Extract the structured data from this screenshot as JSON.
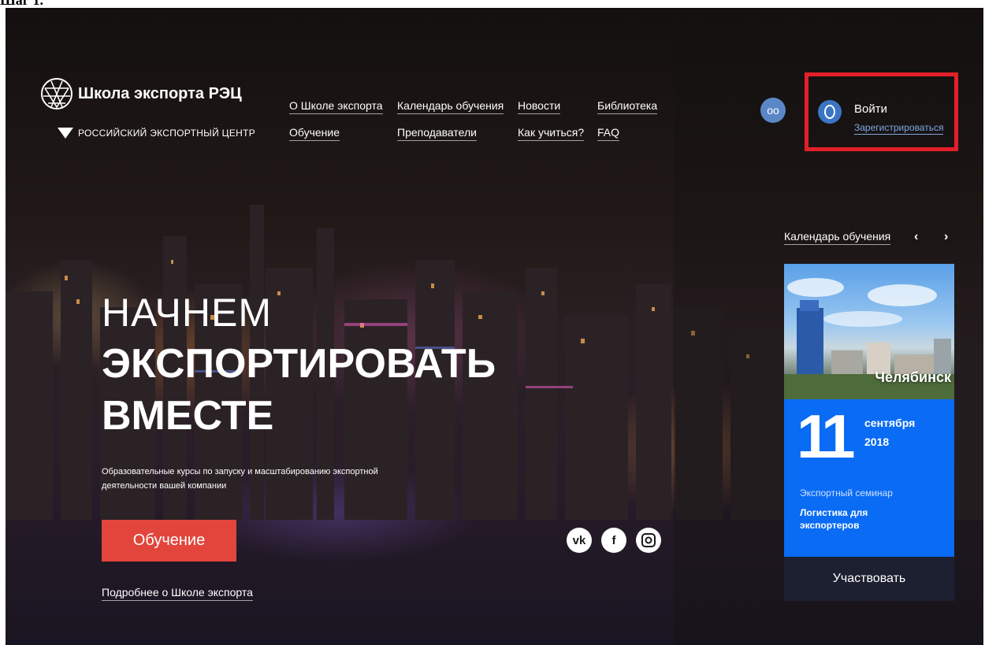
{
  "doc_caption": "Шаг 1.",
  "header": {
    "logo_title": "Школа экспорта РЭЦ",
    "logo_subtitle": "РОССИЙСКИЙ ЭКСПОРТНЫЙ ЦЕНТР",
    "nav": [
      "О Школе экспорта",
      "Календарь обучения",
      "Новости",
      "Библиотека",
      "Обучение",
      "Преподаватели",
      "Как учиться?",
      "FAQ"
    ],
    "accessibility_icon": "glasses-icon",
    "login": "Войти",
    "register": "Зарегистрироваться",
    "highlight_color": "#e2202a"
  },
  "hero": {
    "line1": "НАЧНЕМ",
    "line2": "ЭКСПОРТИРОВАТЬ",
    "line3": "ВМЕСТЕ",
    "subtitle": "Образовательные курсы по запуску и масштабированию экспортной деятельности вашей компании",
    "cta": "Обучение",
    "more_link": "Подробнее о Школе экспорта",
    "accent_color": "#e2453b"
  },
  "social": {
    "vk": "vk",
    "fb": "f",
    "ig": "instagram-icon"
  },
  "calendar": {
    "title": "Календарь обучения",
    "prev": "‹",
    "next": "›",
    "card": {
      "city": "Челябинск",
      "day": "11",
      "month": "сентября",
      "year": "2018",
      "type": "Экспортный семинар",
      "topic": "Логистика для экспортеров",
      "cta": "Участвовать",
      "accent_color": "#0a6bf5"
    }
  }
}
